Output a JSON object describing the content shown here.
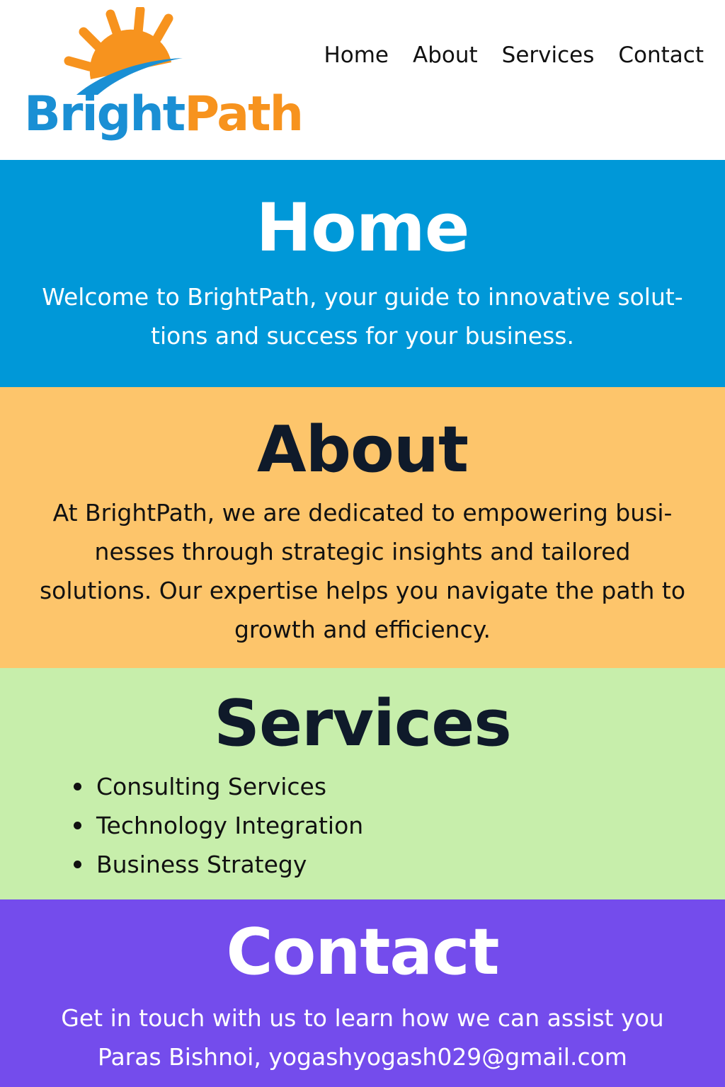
{
  "brand": {
    "name_part1": "Bright",
    "name_part2": "Path",
    "logo_icon": "sunrise-icon",
    "colors": {
      "blue": "#1a8fd4",
      "orange": "#f7931e"
    }
  },
  "nav": {
    "items": [
      {
        "label": "Home"
      },
      {
        "label": "About"
      },
      {
        "label": "Services"
      },
      {
        "label": "Contact"
      }
    ]
  },
  "home": {
    "title": "Home",
    "text": "Welcome to BrightPath, your guide to innovative solut-tions and success for your business.",
    "bg": "#0098d8"
  },
  "about": {
    "title": "About",
    "text": "At BrightPath, we are dedicated to empowering busi-nesses through strategic insights and tailored solutions. Our expertise helps you navigate the path to growth and efficiency.",
    "bg": "#fdc56b"
  },
  "services": {
    "title": "Services",
    "items": [
      {
        "label": "Consulting Services"
      },
      {
        "label": "Technology Integration"
      },
      {
        "label": "Business Strategy"
      }
    ],
    "bg": "#c7eeab"
  },
  "contact": {
    "title": "Contact",
    "text": "Get in touch with us to learn how we can assist you",
    "details": "Paras Bishnoi, yogashyogash029@gmail.com",
    "bg": "#744cec"
  }
}
